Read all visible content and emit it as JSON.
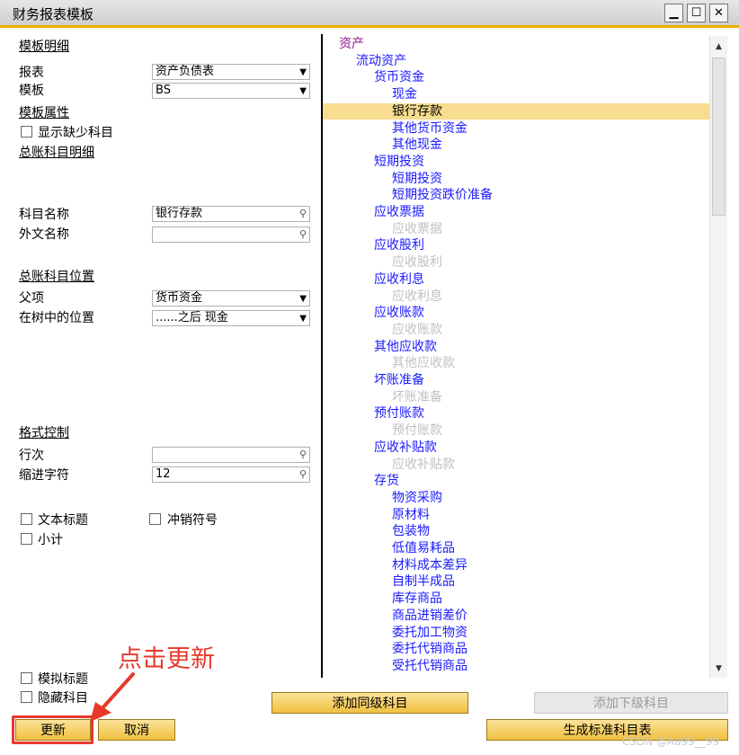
{
  "window": {
    "title": "财务报表模板"
  },
  "left": {
    "section_template_detail": "模板明细",
    "report_label": "报表",
    "report_value": "资产负债表",
    "template_label": "模板",
    "template_value": "BS",
    "section_template_props": "模板属性",
    "show_missing_label": "显示缺少科目",
    "section_gl_detail": "总账科目明细",
    "account_name_label": "科目名称",
    "account_name_value": "银行存款",
    "foreign_name_label": "外文名称",
    "foreign_name_value": "",
    "section_gl_position": "总账科目位置",
    "parent_label": "父项",
    "parent_value": "货币资金",
    "tree_pos_label": "在树中的位置",
    "tree_pos_value": "......之后 现金",
    "section_format": "格式控制",
    "row_label": "行次",
    "row_value": "",
    "indent_label": "缩进字符",
    "indent_value": "12",
    "text_title_label": "文本标题",
    "reversal_label": "冲销符号",
    "subtotal_label": "小计",
    "sim_title_label": "模拟标题",
    "hidden_label": "隐藏科目"
  },
  "tree": {
    "colors": {
      "root": "#8b1a8b",
      "active": "#1a1aff",
      "inactive": "#c0c0c0"
    },
    "items": [
      {
        "label": "资产",
        "level": 0,
        "state": "root"
      },
      {
        "label": "流动资产",
        "level": 1,
        "state": "active"
      },
      {
        "label": "货币资金",
        "level": 2,
        "state": "active"
      },
      {
        "label": "现金",
        "level": 3,
        "state": "active"
      },
      {
        "label": "银行存款",
        "level": 3,
        "state": "selected"
      },
      {
        "label": "其他货币资金",
        "level": 3,
        "state": "active"
      },
      {
        "label": "其他现金",
        "level": 3,
        "state": "active"
      },
      {
        "label": "短期投资",
        "level": 2,
        "state": "active"
      },
      {
        "label": "短期投资",
        "level": 3,
        "state": "active"
      },
      {
        "label": "短期投资跌价准备",
        "level": 3,
        "state": "active"
      },
      {
        "label": "应收票据",
        "level": 2,
        "state": "active"
      },
      {
        "label": "应收票据",
        "level": 3,
        "state": "inactive"
      },
      {
        "label": "应收股利",
        "level": 2,
        "state": "active"
      },
      {
        "label": "应收股利",
        "level": 3,
        "state": "inactive"
      },
      {
        "label": "应收利息",
        "level": 2,
        "state": "active"
      },
      {
        "label": "应收利息",
        "level": 3,
        "state": "inactive"
      },
      {
        "label": "应收账款",
        "level": 2,
        "state": "active"
      },
      {
        "label": "应收账款",
        "level": 3,
        "state": "inactive"
      },
      {
        "label": "其他应收款",
        "level": 2,
        "state": "active"
      },
      {
        "label": "其他应收款",
        "level": 3,
        "state": "inactive"
      },
      {
        "label": "坏账准备",
        "level": 2,
        "state": "active"
      },
      {
        "label": "坏账准备",
        "level": 3,
        "state": "inactive"
      },
      {
        "label": "预付账款",
        "level": 2,
        "state": "active"
      },
      {
        "label": "预付账款",
        "level": 3,
        "state": "inactive"
      },
      {
        "label": "应收补贴款",
        "level": 2,
        "state": "active"
      },
      {
        "label": "应收补贴款",
        "level": 3,
        "state": "inactive"
      },
      {
        "label": "存货",
        "level": 2,
        "state": "active"
      },
      {
        "label": "物资采购",
        "level": 3,
        "state": "active"
      },
      {
        "label": "原材料",
        "level": 3,
        "state": "active"
      },
      {
        "label": "包装物",
        "level": 3,
        "state": "active"
      },
      {
        "label": "低值易耗品",
        "level": 3,
        "state": "active"
      },
      {
        "label": "材料成本差异",
        "level": 3,
        "state": "active"
      },
      {
        "label": "自制半成品",
        "level": 3,
        "state": "active"
      },
      {
        "label": "库存商品",
        "level": 3,
        "state": "active"
      },
      {
        "label": "商品进销差价",
        "level": 3,
        "state": "active"
      },
      {
        "label": "委托加工物资",
        "level": 3,
        "state": "active"
      },
      {
        "label": "委托代销商品",
        "level": 3,
        "state": "active"
      },
      {
        "label": "受托代销商品",
        "level": 3,
        "state": "active"
      }
    ]
  },
  "buttons": {
    "add_sibling": "添加同级科目",
    "add_child": "添加下级科目",
    "update": "更新",
    "cancel": "取消",
    "generate": "生成标准科目表"
  },
  "annotation": "点击更新",
  "watermark": "CSDN @Aa99__99"
}
